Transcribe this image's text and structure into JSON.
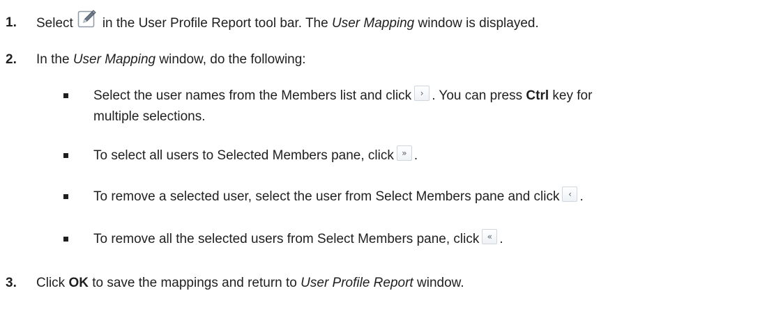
{
  "steps": [
    {
      "num": "1.",
      "pre": "Select",
      "post": "in the User Profile Report tool bar. The",
      "italic": "User Mapping",
      "tail": "window is displayed.",
      "icon": "edit-icon"
    },
    {
      "num": "2.",
      "pre": "In the",
      "italic": "User Mapping",
      "post": "window, do the following:"
    },
    {
      "num": "3.",
      "pre": "Click",
      "bold": "OK",
      "post": "to save the mappings and return to",
      "italic": "User Profile Report",
      "tail": "window."
    }
  ],
  "bullets": [
    {
      "line1_pre": "Select the user names from the Members list and click",
      "button_glyph": "›",
      "button_icon": "move-right-icon",
      "line1_post": ". You can press",
      "bold": "Ctrl",
      "line1_tail": "key for",
      "line2": "multiple selections."
    },
    {
      "pre": "To select all users to Selected Members pane, click",
      "button_glyph": "»",
      "button_icon": "move-all-right-icon",
      "post": "."
    },
    {
      "pre": "To remove a selected user, select the user from Select Members pane and click",
      "button_glyph": "‹",
      "button_icon": "move-left-icon",
      "post": "."
    },
    {
      "pre": "To remove all the selected users from Select Members pane, click",
      "button_glyph": "«",
      "button_icon": "move-all-left-icon",
      "post": "."
    }
  ]
}
